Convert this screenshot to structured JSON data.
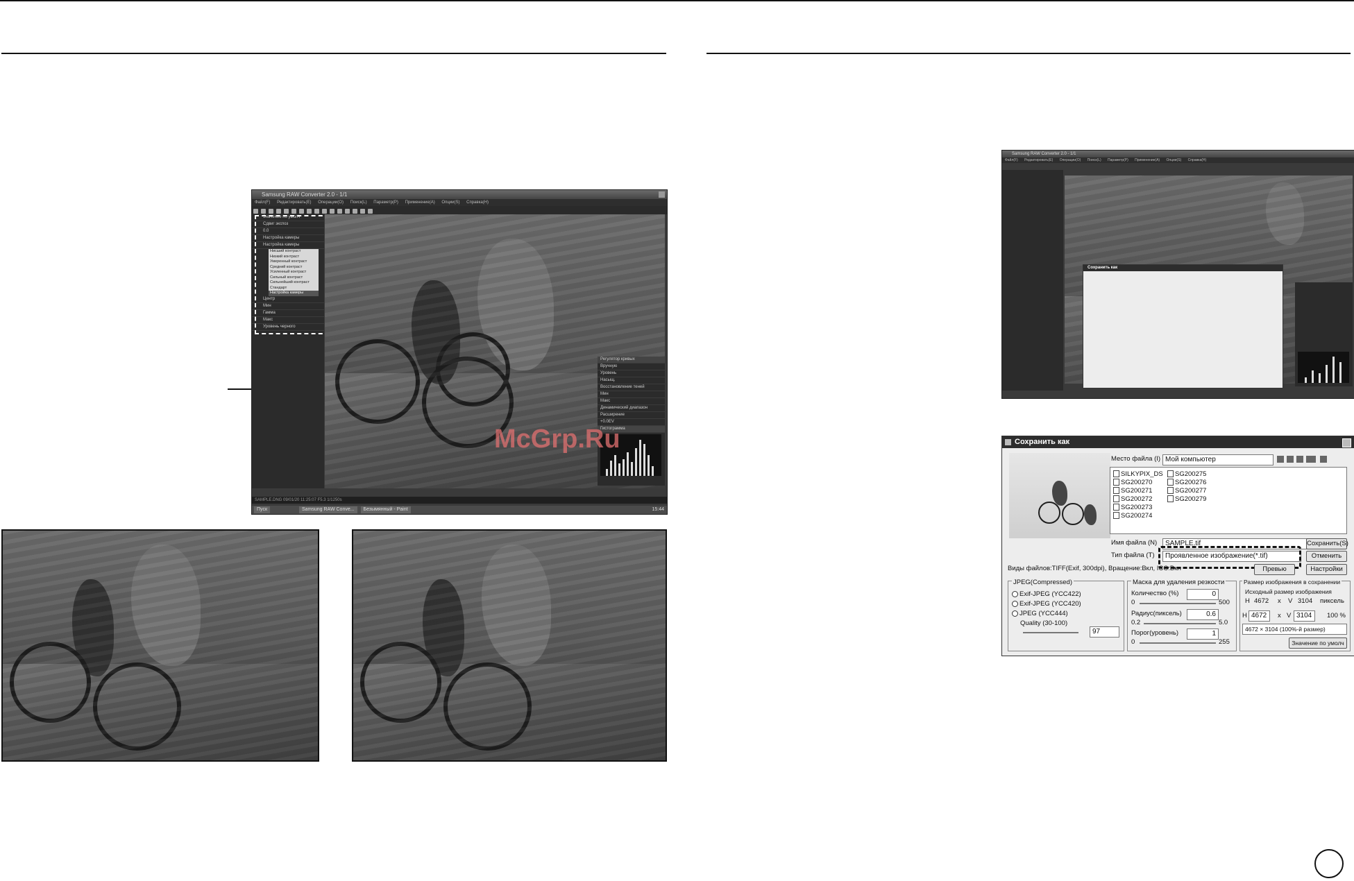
{
  "page": {
    "watermark": "McGrp.Ru"
  },
  "raw_converter": {
    "title": "Samsung RAW Converter 2.0 - 1/1",
    "menu": [
      "Файл(F)",
      "Редактировать(E)",
      "Операции(O)",
      "Поиск(L)",
      "Параметр(P)",
      "Применение(A)",
      "Опции(S)",
      "Справка(H)"
    ],
    "left_panel": {
      "items": [
        "Значение по умолч",
        "Сдвиг экспоз",
        "0.0",
        "Настройка камеры",
        "Настройка камеры"
      ],
      "dropdown": [
        "Нисший контраст",
        "Низкий контраст",
        "Умеренный контраст",
        "Средний контраст",
        "Усиленный контраст",
        "Сильный контраст",
        "Сильнейший контраст",
        "Стандарт",
        "Настройка камеры"
      ],
      "labels": [
        "Центр",
        "Мин",
        "Гамма",
        "Макс",
        "Уровень черного"
      ]
    },
    "curve_panel": {
      "title": "Регулятор кривых",
      "mode": "Вручную",
      "labels": [
        "Уровень",
        "Насыщ.",
        "Восстановление теней",
        "Мин",
        "Макс",
        "Динамический диапазон",
        "Расширение",
        "+0.0EV"
      ],
      "histogram_title": "Гистограмма"
    },
    "status": "SAMPLE.DNG 09/01/20 11:25:07 F5.3 1/1250s",
    "taskbar": {
      "start": "Пуск",
      "tasks": [
        "Samsung RAW Conve...",
        "Безымянный - Paint"
      ],
      "clock": "15:44"
    }
  },
  "raw_converter_small": {
    "title": "Samsung RAW Converter 2.0 - 1/1",
    "dialog_title": "Сохранить как"
  },
  "save_dialog": {
    "title": "Сохранить как",
    "location_label": "Место файла (I)",
    "location_value": "Мой компьютер",
    "files_col1": [
      "SILKYPIX_DS",
      "SG200270",
      "SG200271",
      "SG200272",
      "SG200273",
      "SG200274"
    ],
    "files_col2": [
      "SG200275",
      "SG200276",
      "SG200277",
      "SG200279"
    ],
    "filename_label": "Имя файла (N)",
    "filename_value": "SAMPLE.tif",
    "filetype_label": "Тип файла (T)",
    "filetype_value": "Проявленное изображение(*.tif)",
    "info": "Виды файлов:TIFF(Exif, 300dpi), Вращение:Вкл, ICC:Вкл",
    "save_button": "Сохранить(S)",
    "cancel_button": "Отменить",
    "preview_button": "Превью",
    "settings_button": "Настройки",
    "jpeg_group": "JPEG(Compressed)",
    "jpeg_options": [
      "Exif-JPEG (YCC422)",
      "Exif-JPEG (YCC420)",
      "JPEG (YCC444)"
    ],
    "quality_label": "Quality (30-100)",
    "quality_value": "97",
    "mask_group": "Маска для удаления резкости",
    "amount_label": "Количество (%)",
    "amount_value": "0",
    "amount_min": "0",
    "amount_max": "500",
    "radius_label": "Радиус(пиксель)",
    "radius_value": "0.6",
    "radius_min": "0.2",
    "radius_max": "5.0",
    "threshold_label": "Порог(уровень)",
    "threshold_value": "1",
    "threshold_min": "0",
    "threshold_max": "255",
    "size_group": "Размер изображения в сохранении",
    "orig_size_label": "Исходный размер изображения",
    "orig_h": "4672",
    "orig_v": "3104",
    "orig_unit": "пиксель",
    "h_label": "H",
    "v_label": "V",
    "x_label": "x",
    "new_h": "4672",
    "new_v": "3104",
    "percent": "100 %",
    "size_select": "4672 × 3104 (100%-й размер)",
    "default_button": "Значение по умолч"
  }
}
